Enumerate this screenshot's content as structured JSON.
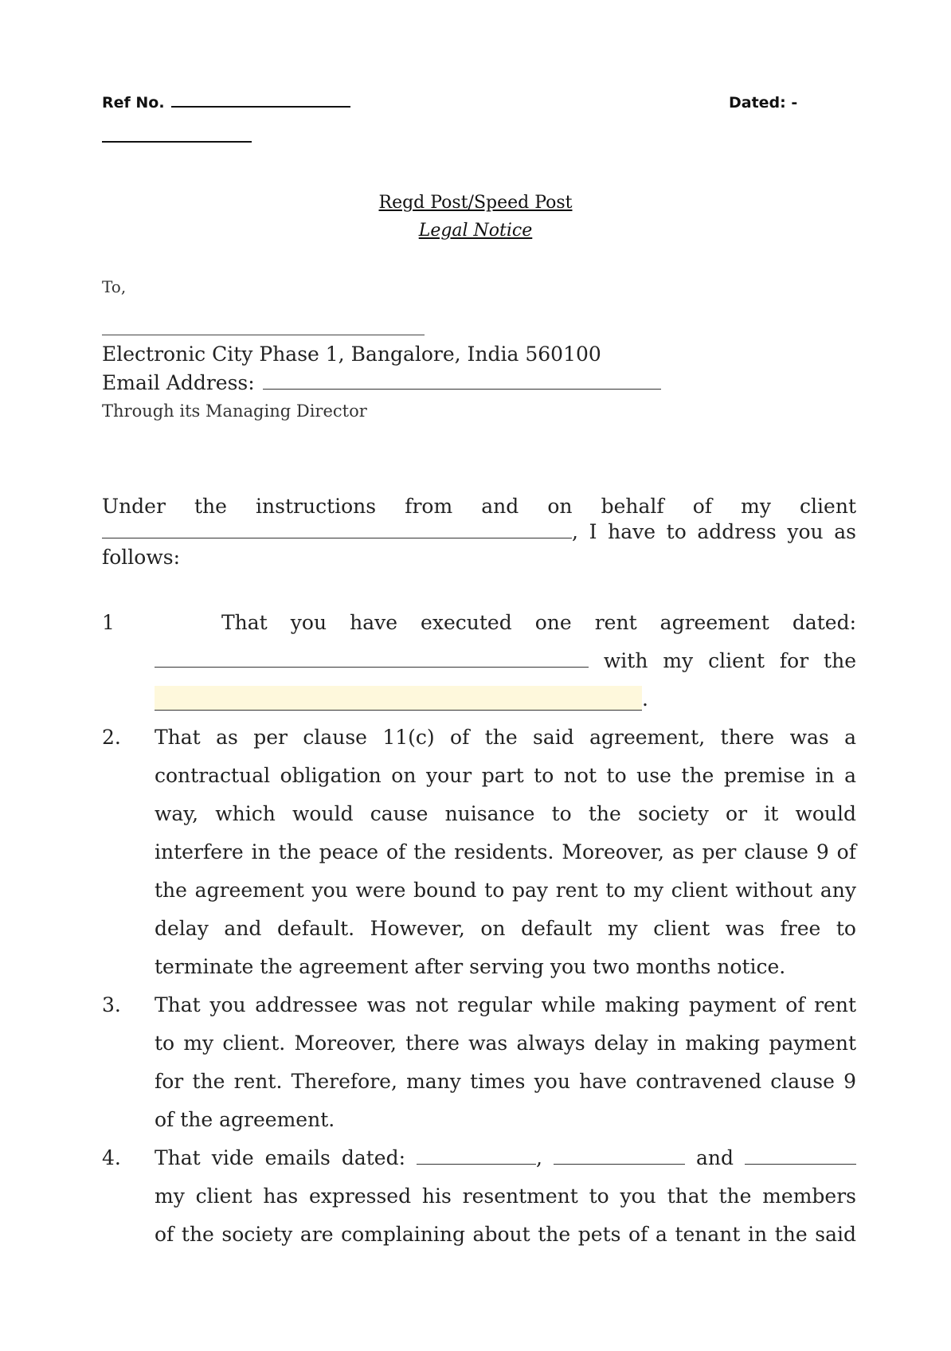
{
  "header": {
    "ref_label": "Ref  No.",
    "dated_label": "Dated: -"
  },
  "title": {
    "delivery_mode": "Regd Post/Speed Post",
    "document_type": "Legal Notice"
  },
  "addressee": {
    "salutation": "To,",
    "address": "Electronic City Phase 1, Bangalore, India 560100",
    "email_label": "Email Address:",
    "through": "Through its Managing Director"
  },
  "intro": {
    "line1": "Under the instructions from and on behalf of my client",
    "line2_suffix": ", I have to address you as",
    "line3": "follows:"
  },
  "items": [
    {
      "number": "1",
      "line1": "That you have executed one rent agreement dated:",
      "line2_suffix": "with my client for the",
      "line3_suffix": "."
    },
    {
      "number": "2.",
      "lines": [
        "That as per clause 11(c) of the said agreement, there was a",
        "contractual obligation on your part to not to use the premise in a",
        "way, which would cause nuisance to the society or it would",
        "interfere in the peace of the residents. Moreover, as per clause 9 of",
        "the agreement you were bound to pay rent to my client without any",
        "delay and default. However, on default my client was free to",
        "terminate the agreement after serving you two months notice."
      ]
    },
    {
      "number": "3.",
      "lines": [
        "That you addressee was not regular while making payment of rent",
        "to my client. Moreover, there was always delay in making payment",
        "for the rent. Therefore, many times you have contravened clause 9",
        "of the agreement."
      ]
    },
    {
      "number": "4.",
      "line1_prefix": "That vide emails dated:",
      "line1_sep1": ",",
      "line1_sep2": "and",
      "lines": [
        "my client has expressed his resentment to you that the members",
        "of the society are complaining about the pets of a tenant in the said"
      ]
    }
  ],
  "colors": {
    "highlight": "#fef8dc",
    "text": "#222222"
  }
}
